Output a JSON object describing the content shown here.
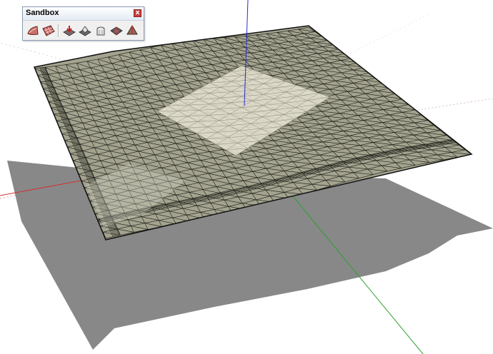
{
  "toolbar": {
    "title": "Sandbox",
    "close_glyph": "x",
    "close_color": "#c84040",
    "buttons": [
      {
        "name": "from-contours",
        "icon": "terrain-from-contours-icon"
      },
      {
        "name": "from-scratch",
        "icon": "terrain-from-scratch-icon"
      },
      {
        "name": "smoove",
        "icon": "smoove-icon"
      },
      {
        "name": "stamp",
        "icon": "stamp-icon"
      },
      {
        "name": "drape",
        "icon": "drape-icon"
      },
      {
        "name": "add-detail",
        "icon": "add-detail-icon"
      },
      {
        "name": "flip-edge",
        "icon": "flip-edge-icon"
      }
    ]
  },
  "scene": {
    "terrain_color": "#a3a38f",
    "terrain_edge_color": "#1a1a14",
    "stamp_face_color": "#e9e4d4",
    "shadow_color": "#888888",
    "axis_colors": {
      "red": "#d03030",
      "green": "#2fa02f",
      "blue": "#2a2ad0"
    }
  }
}
